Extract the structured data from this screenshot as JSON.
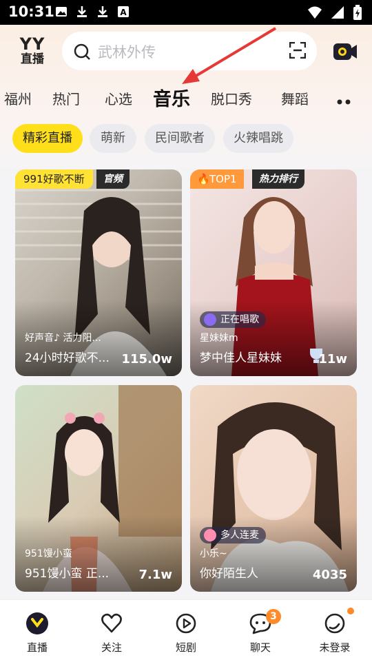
{
  "status_bar": {
    "time": "10:31"
  },
  "header": {
    "logo_top": "YY",
    "logo_bottom": "直播",
    "search_placeholder": "武林外传"
  },
  "tabs": [
    {
      "label": "福州",
      "active": false
    },
    {
      "label": "热门",
      "active": false
    },
    {
      "label": "心选",
      "active": false
    },
    {
      "label": "音乐",
      "active": true
    },
    {
      "label": "脱口秀",
      "active": false
    },
    {
      "label": "舞蹈",
      "active": false
    }
  ],
  "chips": [
    {
      "label": "精彩直播",
      "active": true
    },
    {
      "label": "萌新",
      "active": false
    },
    {
      "label": "民间歌者",
      "active": false
    },
    {
      "label": "火辣唱跳",
      "active": false
    }
  ],
  "cards": [
    {
      "badge": "991好歌不断",
      "tag": "官频",
      "sub": "好声音♪  活力阳...",
      "title": "24小时好歌不...",
      "count": "115.0w"
    },
    {
      "badge": "TOP1",
      "tag": "热力排行",
      "pill": "正在唱歌",
      "sub": "星妹妹m",
      "title": "梦中佳人星妹妹",
      "count": "11w"
    },
    {
      "sub": "951馒小蛮",
      "title": "951馒小蛮 正...",
      "count": "7.1w"
    },
    {
      "pill": "多人连麦",
      "sub": "小乐~",
      "title": "你好陌生人",
      "count": "4035"
    }
  ],
  "bottom_nav": [
    {
      "label": "直播",
      "icon": "live-icon"
    },
    {
      "label": "关注",
      "icon": "heart-icon"
    },
    {
      "label": "短剧",
      "icon": "play-icon"
    },
    {
      "label": "聊天",
      "icon": "chat-icon",
      "badge": "3"
    },
    {
      "label": "未登录",
      "icon": "profile-icon"
    }
  ],
  "colors": {
    "accent": "#ffdf1a",
    "arrow": "#e53935",
    "badge_orange": "#ff8a2a"
  }
}
